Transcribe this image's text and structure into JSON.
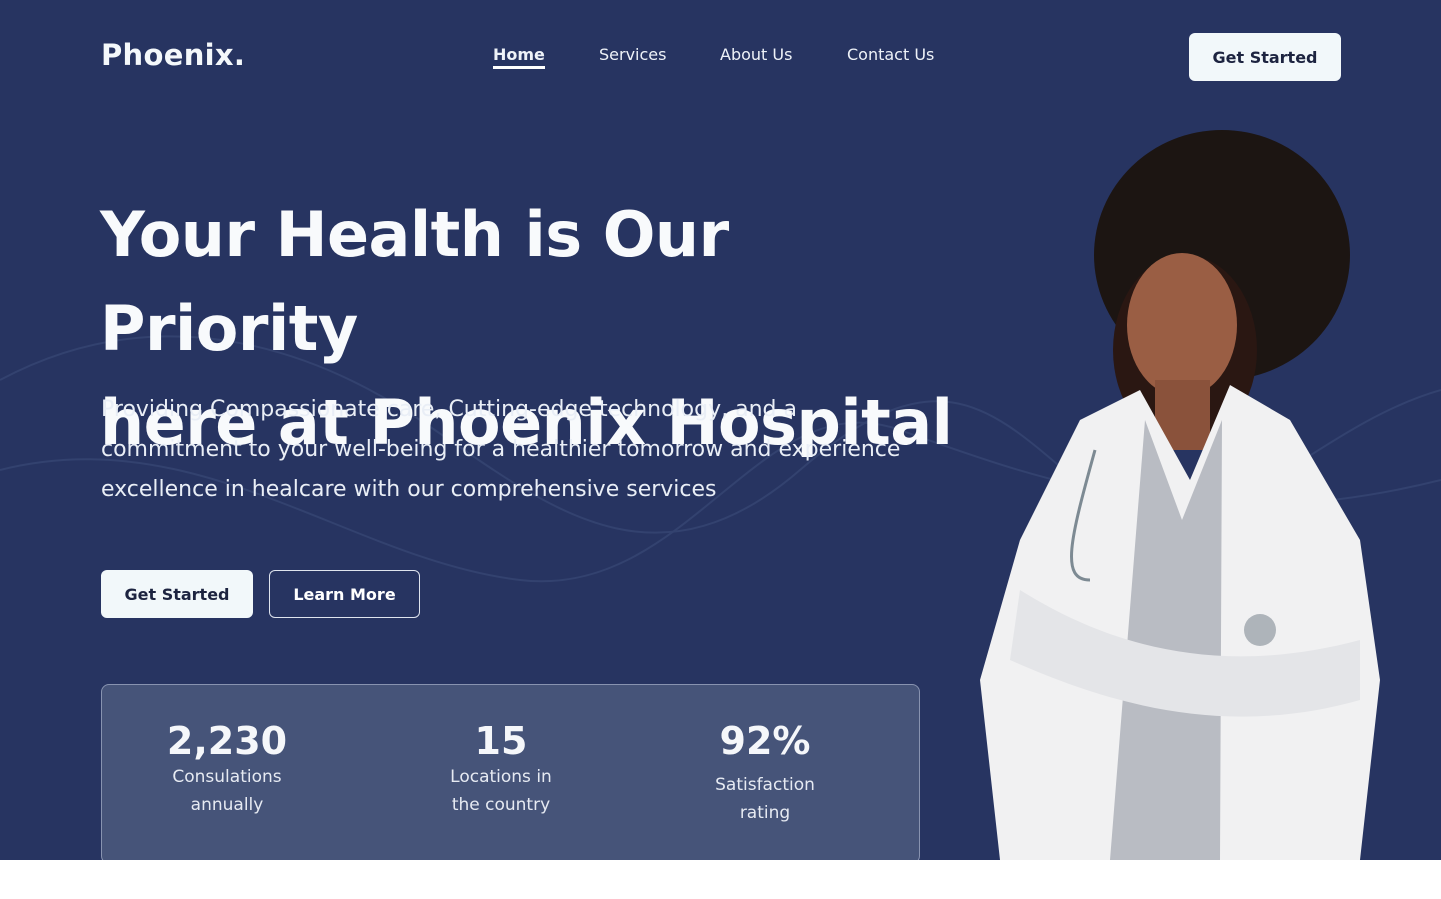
{
  "brand": "Phoenix.",
  "nav": [
    {
      "label": "Home",
      "active": true
    },
    {
      "label": "Services"
    },
    {
      "label": "About Us"
    },
    {
      "label": "Contact Us"
    }
  ],
  "header_cta": "Get Started",
  "hero": {
    "title_line1": "Your Health is Our Priority",
    "title_line2": "here at Phoenix Hospital",
    "subtitle": "Providing Compassionate care, Cutting-edge technology, and a commitment to your well-being for a healthier tomorrow and experience excellence in healcare with our comprehensive services",
    "primary_button": "Get Started",
    "secondary_button": "Learn More"
  },
  "stats": [
    {
      "value": "2,230",
      "label": "Consulations annually"
    },
    {
      "value": "15",
      "label": "Locations in the country"
    },
    {
      "value": "92%",
      "label": "Satisfaction rating"
    }
  ],
  "colors": {
    "background": "#273461",
    "stats_card": "#465479",
    "button_light": "#f2f8fa"
  }
}
